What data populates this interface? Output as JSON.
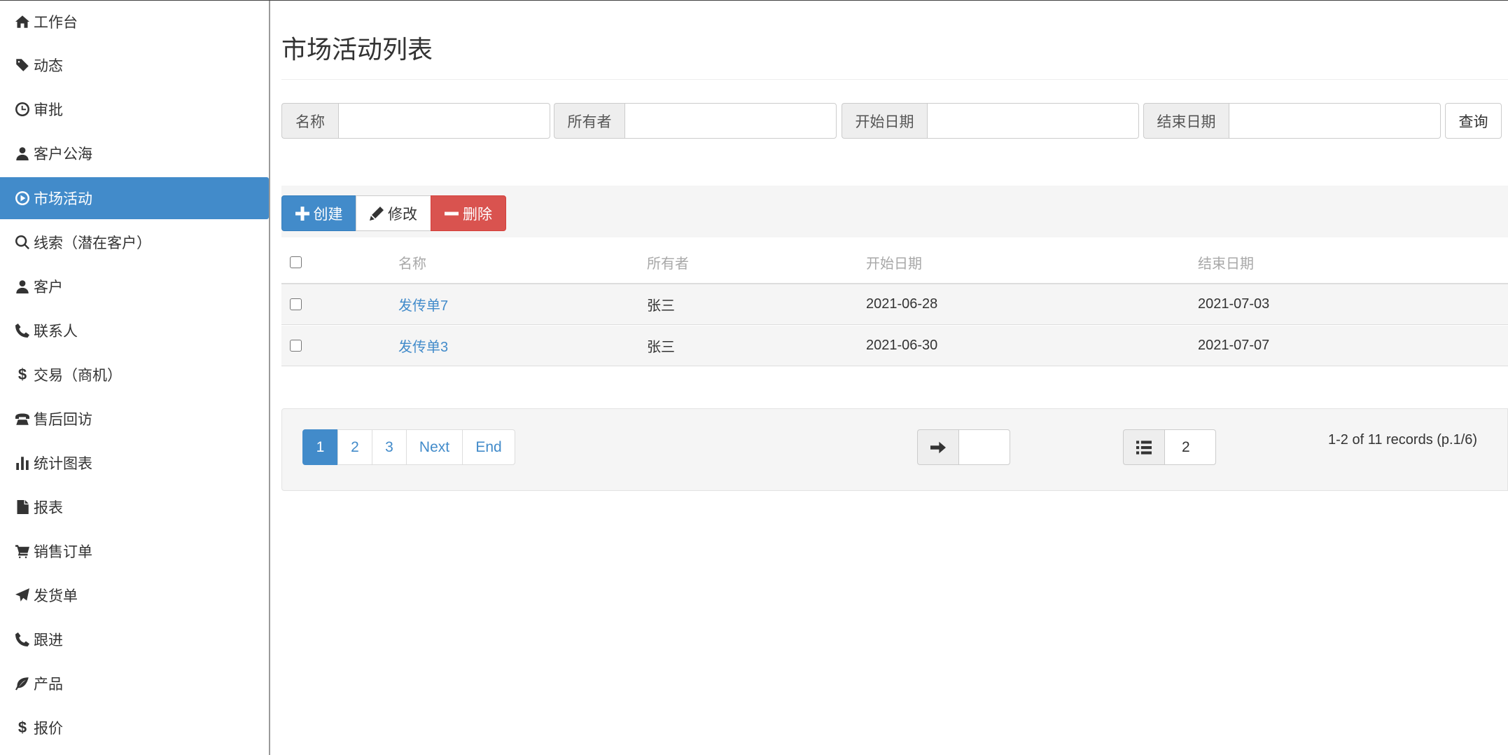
{
  "sidebar": {
    "items": [
      {
        "label": "工作台",
        "icon": "home-icon",
        "active": false
      },
      {
        "label": "动态",
        "icon": "tag-icon",
        "active": false
      },
      {
        "label": "审批",
        "icon": "clock-icon",
        "active": false
      },
      {
        "label": "客户公海",
        "icon": "user-icon",
        "active": false
      },
      {
        "label": "市场活动",
        "icon": "play-circle-icon",
        "active": true
      },
      {
        "label": "线索（潜在客户）",
        "icon": "search-icon",
        "active": false
      },
      {
        "label": "客户",
        "icon": "user-icon",
        "active": false
      },
      {
        "label": "联系人",
        "icon": "phone-icon",
        "active": false
      },
      {
        "label": "交易（商机）",
        "icon": "dollar-icon",
        "active": false
      },
      {
        "label": "售后回访",
        "icon": "phone-alt-icon",
        "active": false
      },
      {
        "label": "统计图表",
        "icon": "stats-icon",
        "active": false
      },
      {
        "label": "报表",
        "icon": "file-icon",
        "active": false
      },
      {
        "label": "销售订单",
        "icon": "cart-icon",
        "active": false
      },
      {
        "label": "发货单",
        "icon": "send-icon",
        "active": false
      },
      {
        "label": "跟进",
        "icon": "phone-icon",
        "active": false
      },
      {
        "label": "产品",
        "icon": "leaf-icon",
        "active": false
      },
      {
        "label": "报价",
        "icon": "dollar-icon",
        "active": false
      }
    ],
    "active_color": "#428bca"
  },
  "main": {
    "title": "市场活动列表",
    "search": {
      "name_label": "名称",
      "owner_label": "所有者",
      "start_label": "开始日期",
      "end_label": "结束日期",
      "query_label": "查询"
    },
    "toolbar": {
      "create_label": "创建",
      "edit_label": "修改",
      "delete_label": "删除"
    },
    "table": {
      "headers": [
        "名称",
        "所有者",
        "开始日期",
        "结束日期"
      ],
      "rows": [
        {
          "name": "发传单7",
          "owner": "张三",
          "start": "2021-06-28",
          "end": "2021-07-03"
        },
        {
          "name": "发传单3",
          "owner": "张三",
          "start": "2021-06-30",
          "end": "2021-07-07"
        }
      ]
    },
    "pagination": {
      "pages": [
        "1",
        "2",
        "3"
      ],
      "active_page": "1",
      "next_label": "Next",
      "end_label": "End",
      "page_size": "2",
      "records_text": "1-2 of 11 records (p.1/6)"
    }
  },
  "colors": {
    "primary": "#428bca",
    "danger": "#d9534f"
  }
}
